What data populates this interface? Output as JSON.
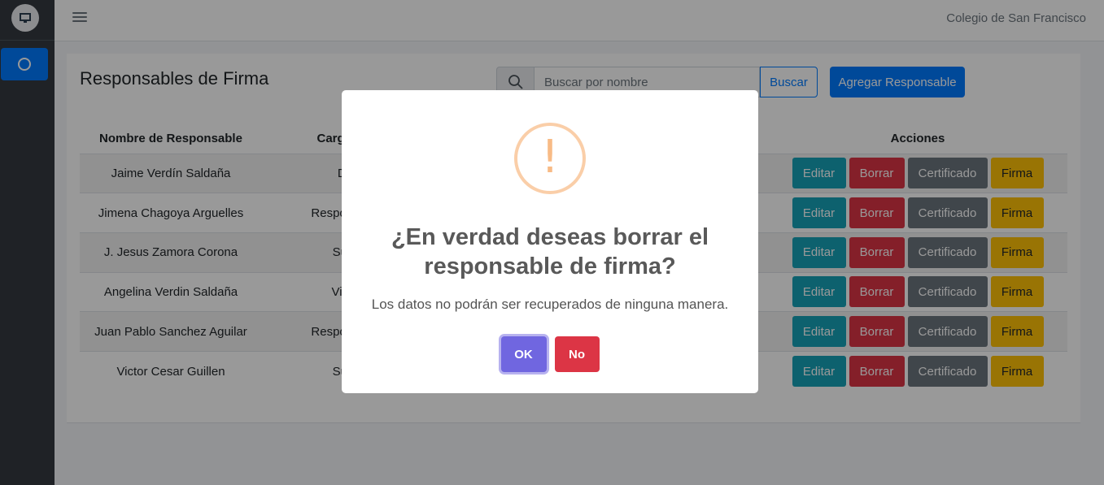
{
  "topbar": {
    "school_name": "Colegio de San Francisco"
  },
  "sidebar": {
    "logo": "school-logo-icon",
    "active_item_icon": "circle-icon"
  },
  "main": {
    "title": "Responsables de Firma",
    "search": {
      "placeholder": "Buscar por nombre",
      "button_label": "Buscar"
    },
    "add_button_label": "Agregar Responsable",
    "table": {
      "headers": [
        "Nombre de Responsable",
        "Cargo de",
        "Acciones"
      ],
      "rows": [
        {
          "name": "Jaime Verdín Saldaña",
          "cargo": "Di"
        },
        {
          "name": "Jimena Chagoya Arguelles",
          "cargo": "Responsabl"
        },
        {
          "name": "J. Jesus Zamora Corona",
          "cargo": "Sub"
        },
        {
          "name": "Angelina Verdin Saldaña",
          "cargo": "Vice"
        },
        {
          "name": "Juan Pablo Sanchez Aguilar",
          "cargo": "Responsabl"
        },
        {
          "name": "Victor Cesar Guillen",
          "cargo": "Sub"
        }
      ],
      "action_labels": {
        "edit": "Editar",
        "delete": "Borrar",
        "certificate": "Certificado",
        "signature": "Firma"
      }
    }
  },
  "modal": {
    "icon": "warning-icon",
    "icon_glyph": "!",
    "title": "¿En verdad deseas borrar el responsable de firma?",
    "text": "Los datos no podrán ser recuperados de ninguna manera.",
    "confirm_label": "OK",
    "cancel_label": "No"
  },
  "colors": {
    "primary": "#007bff",
    "info": "#17a2b8",
    "danger": "#dc3545",
    "secondary": "#6c757d",
    "warning": "#ffc107",
    "modal_confirm": "#7066e0"
  }
}
